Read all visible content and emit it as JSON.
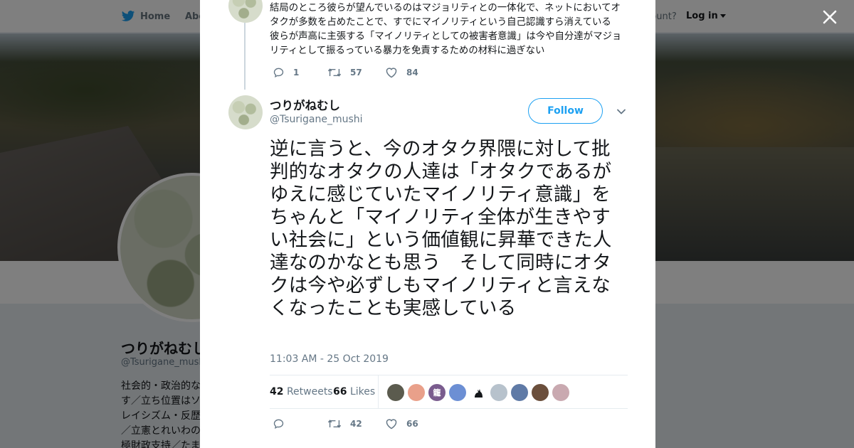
{
  "nav": {
    "home_label": "Home",
    "about_label": "Abo",
    "account_text": "ccount?",
    "login_label": "Log in"
  },
  "profile": {
    "name": "つりがねむし",
    "handle": "@Tsurigane_mushi",
    "bio_lines": [
      "社会的・政治的な",
      "す／立ち位置はソ",
      "レイシズム・反歴",
      "／立憲とれいわの",
      "極財政支持／たま"
    ]
  },
  "previous_tweet": {
    "text": "結局のところ彼らが望んでいるのはマジョリティとの一体化で、ネットにおいてオタクが多数を占めたことで、すでにマイノリティという自己認識すら消えている　彼らが声高に主張する「マイノリティとしての被害者意識」は今や自分達がマジョリティとして振るっている暴力を免責するための材料に過ぎない",
    "replies": "1",
    "retweets": "57",
    "likes": "84"
  },
  "tweet": {
    "author_name": "つりがねむし",
    "author_handle": "@Tsurigane_mushi",
    "follow_label": "Follow",
    "text": "逆に言うと、今のオタク界隈に対して批判的なオタクの人達は「オタクであるがゆえに感じていたマイノリティ意識」をちゃんと「マイノリティ全体が生きやすい社会に」という価値観に昇華できた人達なのかなとも思う　そして同時にオタクは今や必ずしもマイノリティと言えなくなったことも実感している",
    "timestamp": "11:03 AM - 25 Oct 2019",
    "retweet_count": "42",
    "retweets_label": "Retweets",
    "like_count": "66",
    "likes_label": "Likes",
    "reply_count": "",
    "action_retweets": "42",
    "action_likes": "66"
  },
  "likers": [
    {
      "color": "#5b5b4e",
      "glyph": ""
    },
    {
      "color": "#e9a08a",
      "glyph": ""
    },
    {
      "color": "#7a5c8e",
      "glyph": "籠"
    },
    {
      "color": "#6c8fd4",
      "glyph": ""
    },
    {
      "color": "#ffffff",
      "glyph": "cat"
    },
    {
      "color": "#b7c2cc",
      "glyph": ""
    },
    {
      "color": "#5f7aa6",
      "glyph": ""
    },
    {
      "color": "#6b4f3c",
      "glyph": ""
    },
    {
      "color": "#c9a9b0",
      "glyph": ""
    }
  ],
  "colors": {
    "accent": "#1da1f2",
    "muted": "#657786",
    "text": "#14171a",
    "thread_line": "#ccd6dd"
  }
}
